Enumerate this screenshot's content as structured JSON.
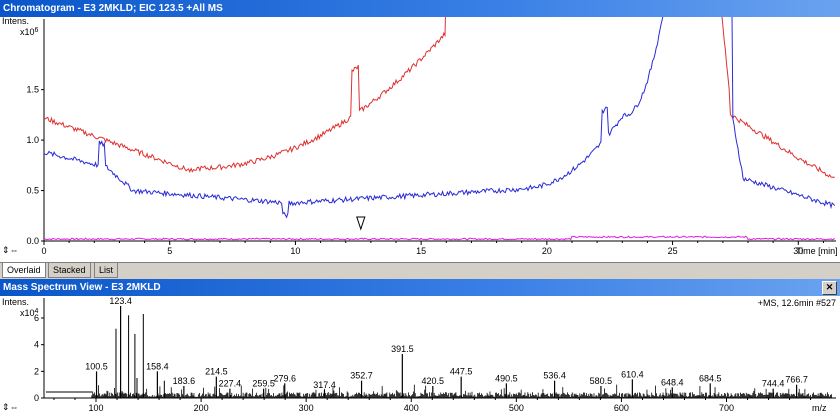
{
  "chromatogram": {
    "title": "Chromatogram - E3 2MKLD; EIC 123.5 +All MS",
    "y_label": "Intens.",
    "y_exponent": "x10",
    "y_exponent_power": "6",
    "y_ticks": [
      "0.0",
      "0.5",
      "1.0",
      "1.5"
    ],
    "x_ticks": [
      "0",
      "5",
      "10",
      "15",
      "20",
      "25",
      "30"
    ],
    "x_label": "Time [min]",
    "colors": {
      "red_trace": "#e03030",
      "blue_trace": "#2a2ad8",
      "pink_trace": "#e020e0"
    }
  },
  "tabs": [
    {
      "label": "Overlaid"
    },
    {
      "label": "Stacked"
    },
    {
      "label": "List"
    }
  ],
  "mass_spectrum": {
    "title": "Mass Spectrum View - E3 2MKLD",
    "info": "+MS, 12.6min #527",
    "y_label": "Intens.",
    "y_exponent": "x10",
    "y_exponent_power": "4",
    "y_ticks": [
      "0",
      "2",
      "4",
      "6"
    ],
    "x_ticks": [
      "100",
      "200",
      "300",
      "400",
      "500",
      "600",
      "700"
    ],
    "x_label": "m/z",
    "peak_labels": [
      {
        "text": "100.5",
        "mz": 100.5,
        "intensity": 2.0
      },
      {
        "text": "123.4",
        "mz": 123.4,
        "intensity": 6.9
      },
      {
        "text": "158.4",
        "mz": 158.4,
        "intensity": 2.0
      },
      {
        "text": "183.6",
        "mz": 183.6,
        "intensity": 0.9
      },
      {
        "text": "214.5",
        "mz": 214.5,
        "intensity": 1.6
      },
      {
        "text": "227.4",
        "mz": 227.4,
        "intensity": 0.7
      },
      {
        "text": "259.5",
        "mz": 259.5,
        "intensity": 0.7
      },
      {
        "text": "279.6",
        "mz": 279.6,
        "intensity": 1.1
      },
      {
        "text": "317.4",
        "mz": 317.4,
        "intensity": 0.6
      },
      {
        "text": "352.7",
        "mz": 352.7,
        "intensity": 1.3
      },
      {
        "text": "391.5",
        "mz": 391.5,
        "intensity": 3.3
      },
      {
        "text": "420.5",
        "mz": 420.5,
        "intensity": 0.9
      },
      {
        "text": "447.5",
        "mz": 447.5,
        "intensity": 1.6
      },
      {
        "text": "490.5",
        "mz": 490.5,
        "intensity": 1.1
      },
      {
        "text": "536.4",
        "mz": 536.4,
        "intensity": 1.3
      },
      {
        "text": "580.5",
        "mz": 580.5,
        "intensity": 0.9
      },
      {
        "text": "610.4",
        "mz": 610.4,
        "intensity": 1.4
      },
      {
        "text": "648.4",
        "mz": 648.4,
        "intensity": 0.8
      },
      {
        "text": "684.5",
        "mz": 684.5,
        "intensity": 1.1
      },
      {
        "text": "744.4",
        "mz": 744.4,
        "intensity": 0.7
      },
      {
        "text": "766.7",
        "mz": 766.7,
        "intensity": 1.0
      }
    ]
  }
}
